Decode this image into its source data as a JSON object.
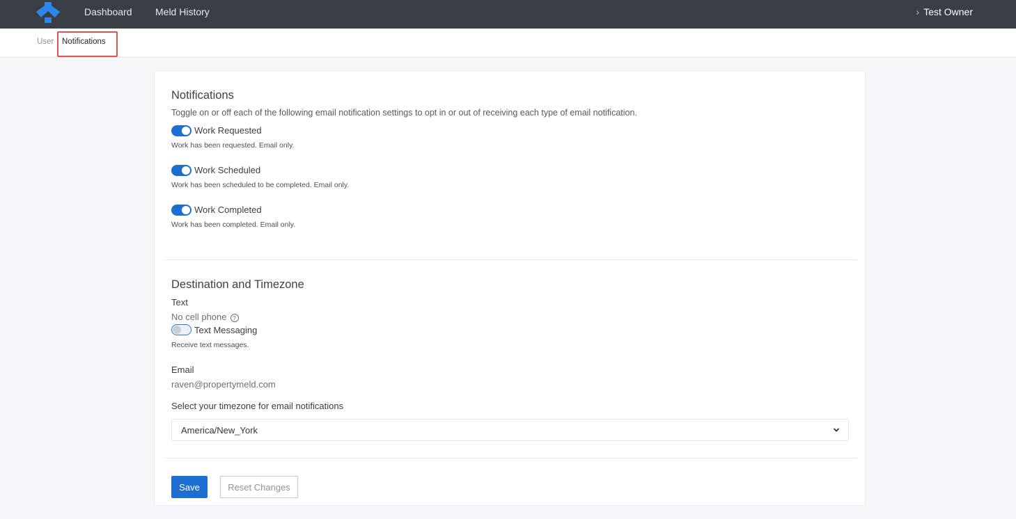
{
  "topnav": {
    "logo_icon": "property-meld-logo-icon",
    "dashboard": "Dashboard",
    "meld_history": "Meld History",
    "user_chevron_icon": "chevron-right-icon",
    "user_name": "Test Owner"
  },
  "subnav": {
    "user": "User",
    "notifications": "Notifications"
  },
  "notifications": {
    "title": "Notifications",
    "description": "Toggle on or off each of the following email notification settings to opt in or out of receiving each type of email notification.",
    "items": [
      {
        "label": "Work Requested",
        "help": "Work has been requested. Email only.",
        "enabled": true
      },
      {
        "label": "Work Scheduled",
        "help": "Work has been scheduled to be completed. Email only.",
        "enabled": true
      },
      {
        "label": "Work Completed",
        "help": "Work has been completed. Email only.",
        "enabled": true
      }
    ]
  },
  "destination": {
    "title": "Destination and Timezone",
    "text_label": "Text",
    "no_phone": "No cell phone",
    "help_icon": "question-circle-icon",
    "text_messaging_label": "Text Messaging",
    "text_messaging_enabled": false,
    "text_messaging_help": "Receive text messages.",
    "email_label": "Email",
    "email_value": "raven@propertymeld.com",
    "timezone_label": "Select your timezone for email notifications",
    "timezone_value": "America/New_York"
  },
  "actions": {
    "save": "Save",
    "reset": "Reset Changes"
  },
  "colors": {
    "topnav_bg": "#3a3e45",
    "accent": "#1c6fd0",
    "highlight_border": "#d9534f"
  }
}
